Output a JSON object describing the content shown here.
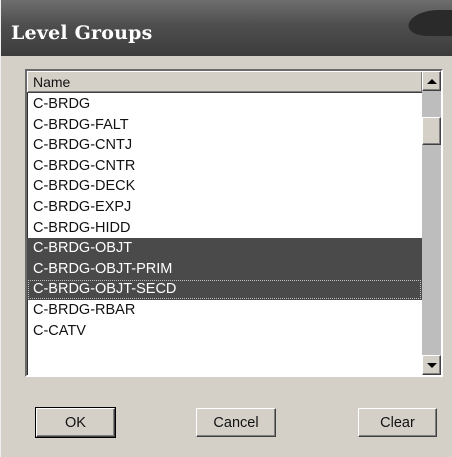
{
  "window": {
    "title": "Level Groups"
  },
  "list": {
    "column_header": "Name",
    "items": [
      {
        "label": "C-BRDG",
        "selected": false
      },
      {
        "label": "C-BRDG-FALT",
        "selected": false
      },
      {
        "label": "C-BRDG-CNTJ",
        "selected": false
      },
      {
        "label": "C-BRDG-CNTR",
        "selected": false
      },
      {
        "label": "C-BRDG-DECK",
        "selected": false
      },
      {
        "label": "C-BRDG-EXPJ",
        "selected": false
      },
      {
        "label": "C-BRDG-HIDD",
        "selected": false
      },
      {
        "label": "C-BRDG-OBJT",
        "selected": true
      },
      {
        "label": "C-BRDG-OBJT-PRIM",
        "selected": true
      },
      {
        "label": "C-BRDG-OBJT-SECD",
        "selected": true
      },
      {
        "label": "C-BRDG-RBAR",
        "selected": false
      },
      {
        "label": "C-CATV",
        "selected": false
      }
    ]
  },
  "buttons": {
    "ok": "OK",
    "cancel": "Cancel",
    "clear": "Clear"
  },
  "icons": {
    "scroll_up": "arrow-up-icon",
    "scroll_down": "arrow-down-icon"
  },
  "colors": {
    "selection": "#4a4a4a",
    "titlebar": "#4e4e4e",
    "dialog": "#d4d0c8"
  }
}
